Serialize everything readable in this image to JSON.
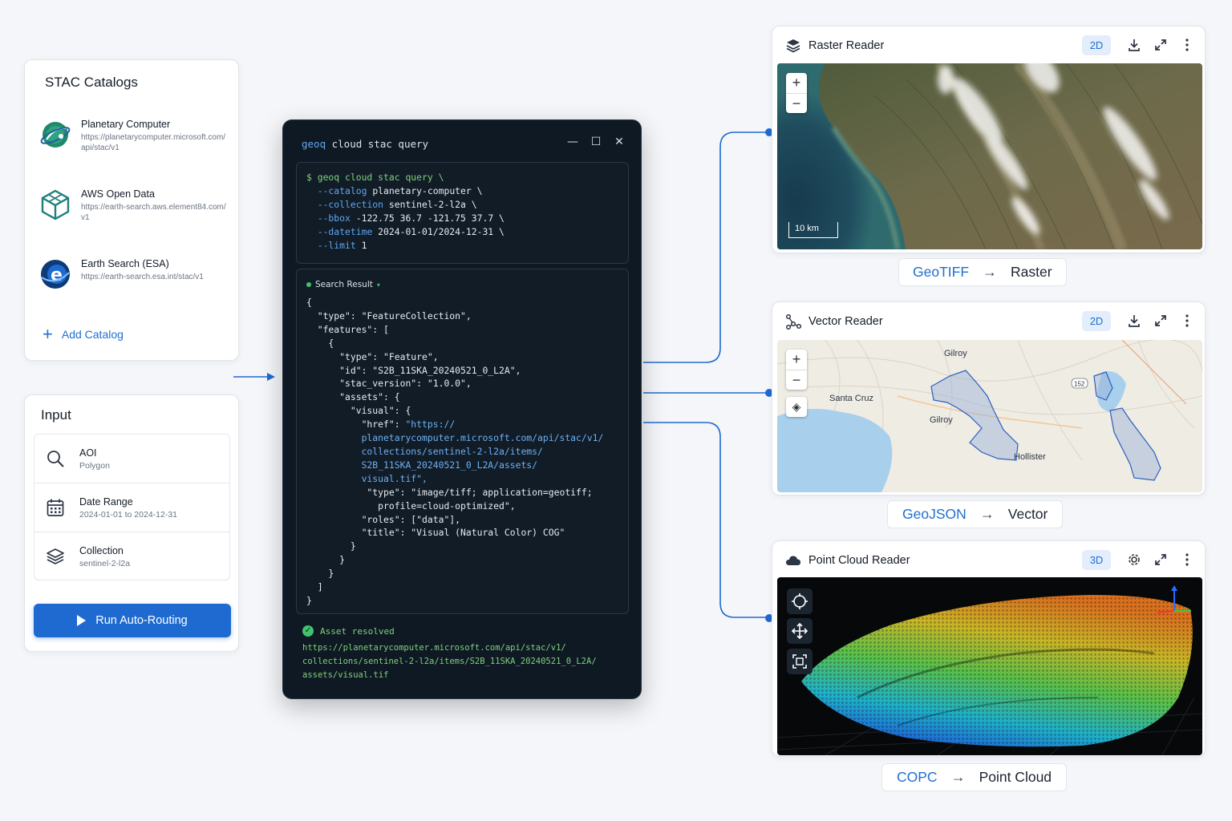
{
  "stac": {
    "title": "STAC Catalogs",
    "items": [
      {
        "name": "Planetary Computer",
        "url": "https://planetarycomputer.microsoft.com/api/stac/v1",
        "icon": "planet-icon"
      },
      {
        "name": "AWS Open Data",
        "url": "https://earth-search.aws.element84.com/v1",
        "icon": "cube-icon"
      },
      {
        "name": "Earth Search (ESA)",
        "url": "https://earth-search.esa.int/stac/v1",
        "icon": "esa-logo-icon"
      }
    ],
    "add_label": "Add Catalog"
  },
  "input": {
    "title": "Input",
    "fields": [
      {
        "label": "AOI",
        "value": "Polygon",
        "icon": "search-icon"
      },
      {
        "label": "Date Range",
        "value": "2024-01-01 to 2024-12-31",
        "icon": "calendar-icon"
      },
      {
        "label": "Collection",
        "value": "sentinel-2-l2a",
        "icon": "layers-icon"
      }
    ],
    "run_label": "Run Auto-Routing"
  },
  "terminal": {
    "title_kw": "geoq",
    "title_rest": " cloud stac query",
    "command": {
      "prompt": "$ geoq cloud stac query \\",
      "args": [
        {
          "flag": "--catalog",
          "value": "planetary-computer \\"
        },
        {
          "flag": "--collection",
          "value": "sentinel-2-l2a \\"
        },
        {
          "flag": "--bbox",
          "value": "-122.75 36.7 -121.75 37.7 \\"
        },
        {
          "flag": "--datetime",
          "value": "2024-01-01/2024-12-31 \\"
        },
        {
          "flag": "--limit",
          "value": "1"
        }
      ]
    },
    "result_label": "Search Result",
    "result_json": {
      "l01": "{",
      "l02": "  \"type\": \"FeatureCollection\",",
      "l03": "  \"features\": [",
      "l04": "    {",
      "l05": "      \"type\": \"Feature\",",
      "l06": "      \"id\": \"S2B_11SKA_20240521_0_L2A\",",
      "l07": "      \"stac_version\": \"1.0.0\",",
      "l08": "      \"assets\": {",
      "l09": "        \"visual\": {",
      "l10a": "          \"href\": ",
      "l10b": "\"https://",
      "l11": "          planetarycomputer.microsoft.com/api/stac/v1/",
      "l12": "          collections/sentinel-2-l2a/items/",
      "l13": "          S2B_11SKA_20240521_0_L2A/assets/",
      "l14": "          visual.tif\",",
      "l15": "           \"type\": \"image/tiff; application=geotiff;",
      "l16": "             profile=cloud-optimized\",",
      "l17": "          \"roles\": [\"data\"],",
      "l18": "          \"title\": \"Visual (Natural Color) COG\"",
      "l19": "        }",
      "l20": "      }",
      "l21": "    }",
      "l22": "  ]",
      "l23": "}"
    },
    "resolved_label": "Asset resolved",
    "resolved_url": [
      "https://planetarycomputer.microsoft.com/api/stac/v1/",
      "collections/sentinel-2-l2a/items/S2B_11SKA_20240521_0_L2A/",
      "assets/visual.tif"
    ]
  },
  "readers": {
    "raster": {
      "title": "Raster Reader",
      "mode": "2D",
      "scale": "10 km",
      "format": "GeoTIFF",
      "kind": "Raster"
    },
    "vector": {
      "title": "Vector Reader",
      "mode": "2D",
      "format": "GeoJSON",
      "kind": "Vector",
      "places": [
        "Gilroy",
        "Santa Cruz",
        "Gilroy",
        "Hollister",
        "152"
      ]
    },
    "pointcloud": {
      "title": "Point Cloud Reader",
      "mode": "3D",
      "format": "COPC",
      "kind": "Point Cloud"
    }
  },
  "colors": {
    "accent": "#1e6ad0",
    "terminal_bg": "#0f1924",
    "success": "#3fc36d"
  }
}
